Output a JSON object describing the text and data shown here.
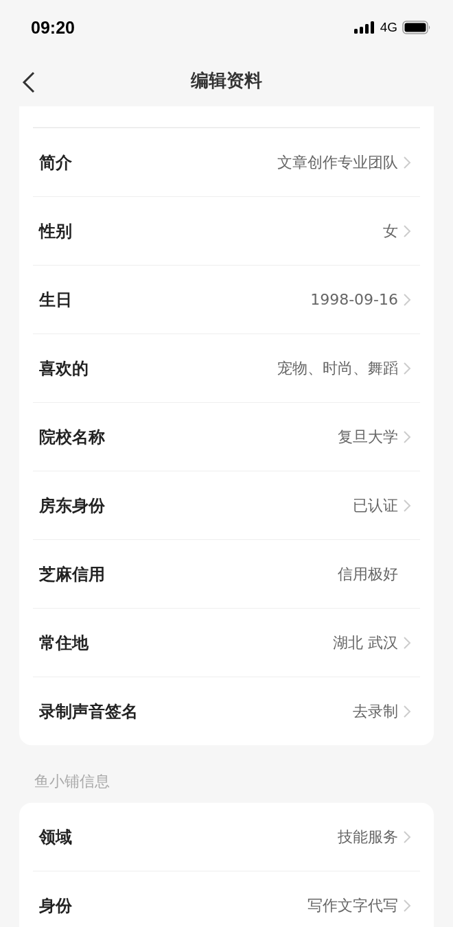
{
  "status_bar": {
    "time": "09:20",
    "network": "4G"
  },
  "nav": {
    "title": "编辑资料"
  },
  "sections": [
    {
      "rows": [
        {
          "label": "简介",
          "value": "文章创作专业团队",
          "chevron": true
        },
        {
          "label": "性别",
          "value": "女",
          "chevron": true
        },
        {
          "label": "生日",
          "value": "1998-09-16",
          "chevron": true
        },
        {
          "label": "喜欢的",
          "value": "宠物、时尚、舞蹈",
          "chevron": true
        },
        {
          "label": "院校名称",
          "value": "复旦大学",
          "chevron": true
        },
        {
          "label": "房东身份",
          "value": "已认证",
          "chevron": true
        },
        {
          "label": "芝麻信用",
          "value": "信用极好",
          "chevron": false
        },
        {
          "label": "常住地",
          "value": "湖北 武汉",
          "chevron": true
        },
        {
          "label": "录制声音签名",
          "value": "去录制",
          "chevron": true
        }
      ]
    },
    {
      "title": "鱼小铺信息",
      "rows": [
        {
          "label": "领域",
          "value": "技能服务",
          "chevron": true
        },
        {
          "label": "身份",
          "value": "写作文字代写",
          "chevron": true
        }
      ]
    }
  ]
}
